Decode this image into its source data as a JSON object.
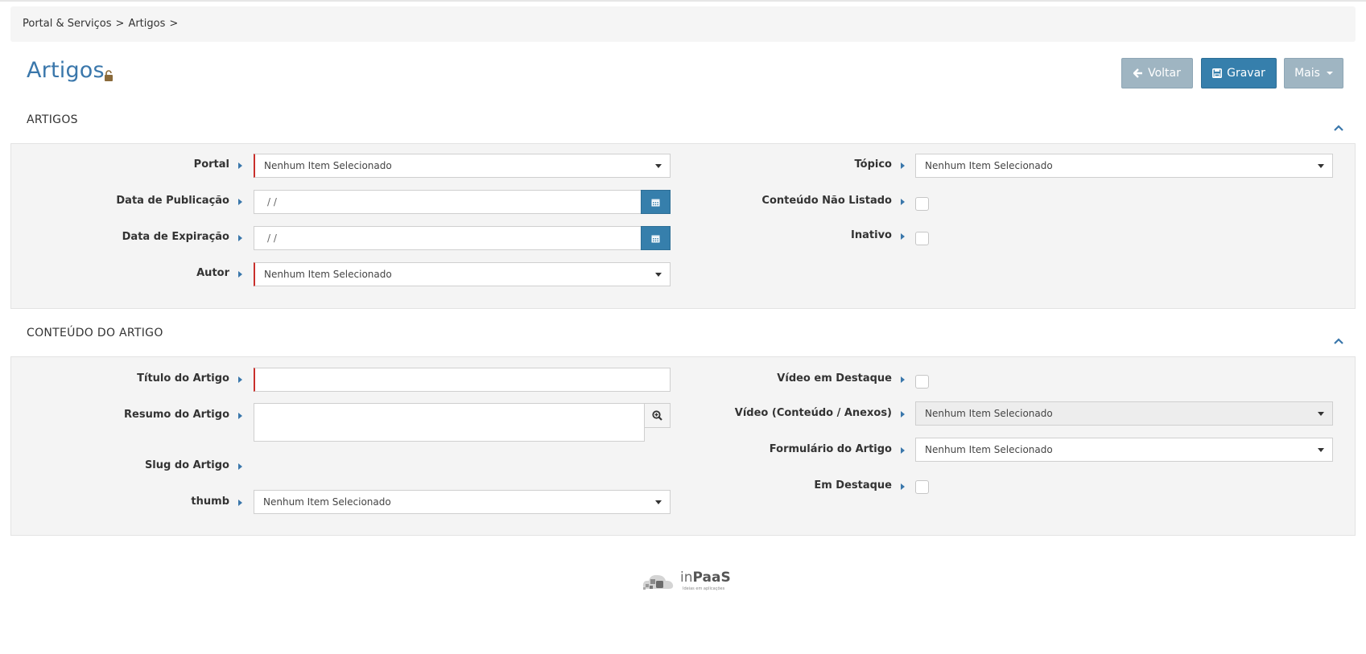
{
  "breadcrumb": {
    "item1": "Portal & Serviços",
    "sep1": ">",
    "item2": "Artigos",
    "sep2": ">"
  },
  "page": {
    "title": "Artigos",
    "lock_icon": "unlock-icon"
  },
  "toolbar": {
    "back_label": "Voltar",
    "save_label": "Gravar",
    "more_label": "Mais"
  },
  "section_artigos": {
    "title": "ARTIGOS",
    "fields": {
      "portal_label": "Portal",
      "portal_value": "Nenhum Item Selecionado",
      "pub_date_label": "Data de Publicação",
      "pub_date_value": "/  /",
      "exp_date_label": "Data de Expiração",
      "exp_date_value": "/  /",
      "autor_label": "Autor",
      "autor_value": "Nenhum Item Selecionado",
      "topico_label": "Tópico",
      "topico_value": "Nenhum Item Selecionado",
      "nao_listado_label": "Conteúdo Não Listado",
      "inativo_label": "Inativo"
    }
  },
  "section_conteudo": {
    "title": "CONTEÚDO DO ARTIGO",
    "fields": {
      "titulo_label": "Título do Artigo",
      "titulo_value": "",
      "resumo_label": "Resumo do Artigo",
      "slug_label": "Slug do Artigo",
      "thumb_label": "thumb",
      "thumb_value": "Nenhum Item Selecionado",
      "video_destaque_label": "Vídeo em Destaque",
      "video_label": "Vídeo (Conteúdo / Anexos)",
      "video_value": "Nenhum Item Selecionado",
      "formulario_label": "Formulário do Artigo",
      "formulario_value": "Nenhum Item Selecionado",
      "em_destaque_label": "Em Destaque"
    }
  },
  "footer": {
    "logo_in": "in",
    "logo_paas": "PaaS",
    "logo_sub": "Ideias em aplicações"
  },
  "colors": {
    "accent": "#367fac",
    "title": "#3a77ab",
    "required": "#c9302c",
    "muted_button": "#9fb5c2"
  }
}
